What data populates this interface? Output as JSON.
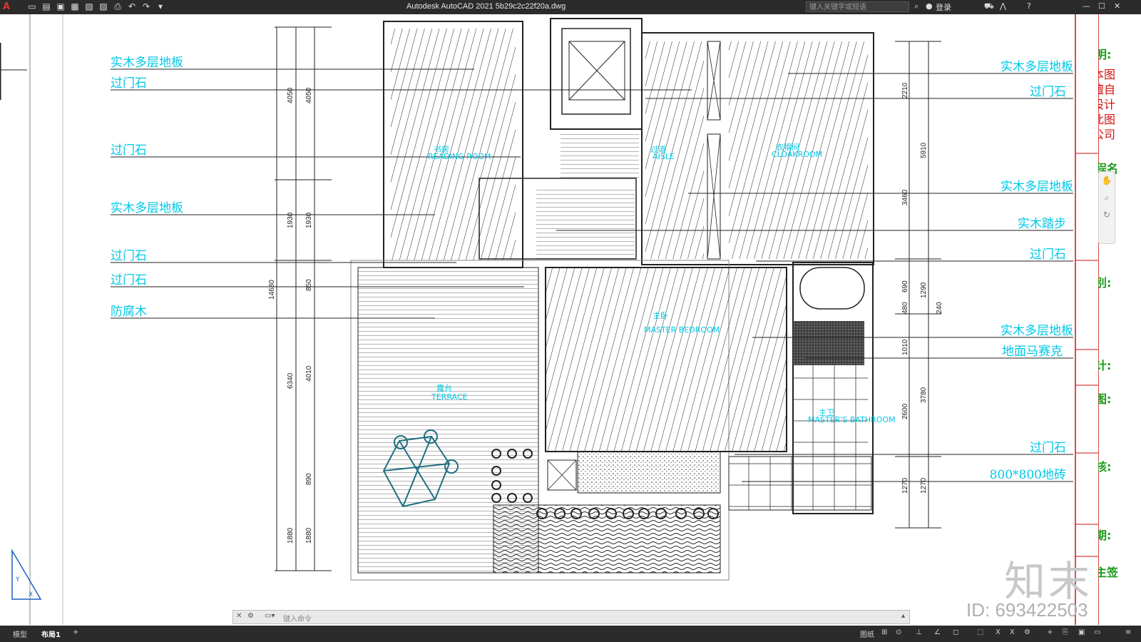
{
  "app": {
    "title": "Autodesk AutoCAD 2021    5b29c2c22f20a.dwg",
    "search_placeholder": "键入关键字或短语",
    "login": "登录"
  },
  "labels_left": [
    {
      "text": "实木多层地板"
    },
    {
      "text": "过门石"
    },
    {
      "text": "过门石"
    },
    {
      "text": "实木多层地板"
    },
    {
      "text": "过门石"
    },
    {
      "text": "过门石"
    },
    {
      "text": "防腐木"
    }
  ],
  "labels_right": [
    {
      "text": "实木多层地板"
    },
    {
      "text": "过门石"
    },
    {
      "text": "实木多层地板"
    },
    {
      "text": "实木踏步"
    },
    {
      "text": "过门石"
    },
    {
      "text": "实木多层地板"
    },
    {
      "text": "地面马赛克"
    },
    {
      "text": "过门石"
    },
    {
      "text": "800*800地砖"
    }
  ],
  "dims_left_outer": [
    "4050",
    "1930",
    "6340",
    "1880"
  ],
  "dims_left_inner": [
    "4050",
    "1930",
    "850",
    "4010",
    "890",
    "1880"
  ],
  "dim_total": "14680",
  "dims_right_outer": [
    "5910",
    "1290",
    "3780",
    "1270"
  ],
  "dims_right_inner": [
    "2210",
    "3460",
    "690",
    "480",
    "1010",
    "2600",
    "1270"
  ],
  "dim_extra": "240",
  "rooms": {
    "study": {
      "cn": "书房",
      "en": "READING ROOM"
    },
    "corridor": {
      "cn": "过道",
      "en": "AISLE"
    },
    "cloak": {
      "cn": "衣帽间",
      "en": "CLOAKROOM"
    },
    "master": {
      "cn": "主卧",
      "en": "MASTER BEDROOM"
    },
    "terrace": {
      "cn": "露台",
      "en": "TERRACE"
    },
    "bath": {
      "cn": "主卫",
      "en": "MASTER'S BATHROOM"
    }
  },
  "right_panel": {
    "statement": "声明:",
    "statement_lines": [
      "本图",
      "擅自",
      "设计",
      "此图",
      "公司"
    ],
    "project": "工程名",
    "drawing_type": "图别:",
    "design": "设计:",
    "drafting": "制图:",
    "review": "审核:",
    "date": "日期:",
    "owner": "业主签"
  },
  "command": {
    "placeholder": "键入命令"
  },
  "status": {
    "model_tab": "模型",
    "layout_tab": "布局1",
    "add": "+",
    "paper": "图纸"
  },
  "watermark": {
    "logo": "知末",
    "id": "ID: 693422503"
  },
  "colors": {
    "cyan": "#00c8e6",
    "titlebar": "#2b2b2b",
    "red": "#d01010"
  }
}
